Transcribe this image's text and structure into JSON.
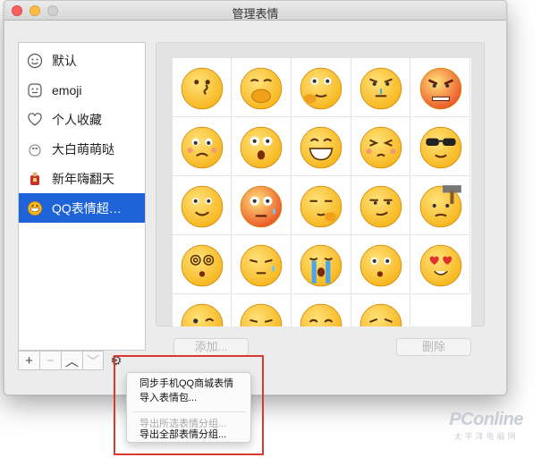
{
  "window": {
    "title": "管理表情"
  },
  "sidebar": {
    "items": [
      {
        "label": "默认",
        "icon": "smiley-outline-icon",
        "selected": false
      },
      {
        "label": "emoji",
        "icon": "emoji-face-outline-icon",
        "selected": false
      },
      {
        "label": "个人收藏",
        "icon": "heart-outline-icon",
        "selected": false
      },
      {
        "label": "大白萌萌哒",
        "icon": "baymax-icon",
        "selected": false
      },
      {
        "label": "新年嗨翻天",
        "icon": "new-year-icon",
        "selected": false
      },
      {
        "label": "QQ表情超…",
        "icon": "qq-face-icon",
        "selected": true
      }
    ],
    "toolbar": {
      "add": "+",
      "remove": "−",
      "up": "︿",
      "down": "﹀",
      "gear": "⚙"
    }
  },
  "grid": {
    "emojis": [
      "kiss-face-icon",
      "cover-mouth-face-icon",
      "thinking-face-icon",
      "sick-face-icon",
      "angry-fire-face-icon",
      "worried-face-icon",
      "shocked-face-icon",
      "grin-face-icon",
      "squint-face-icon",
      "sunglasses-face-icon",
      "smile-face-icon",
      "sweat-red-face-icon",
      "proud-face-icon",
      "smirk-face-icon",
      "hammer-face-icon",
      "dizzy-face-icon",
      "sweat-drop-face-icon",
      "crying-face-icon",
      "confused-face-icon",
      "heart-eyes-face-icon",
      "wink-face-icon",
      "annoyed-face-icon",
      "sad-face-icon",
      "frown-face-icon"
    ]
  },
  "buttons": {
    "add": "添加...",
    "delete": "删除"
  },
  "menu": {
    "items": [
      {
        "label": "同步手机QQ商城表情",
        "enabled": true
      },
      {
        "label": "导入表情包...",
        "enabled": true
      },
      {
        "label": "导出所选表情分组...",
        "enabled": false
      },
      {
        "label": "导出全部表情分组...",
        "enabled": true
      }
    ]
  },
  "watermark": {
    "main": "PConline",
    "sub": "太平洋电脑网"
  },
  "colors": {
    "selection": "#1e64d8",
    "highlight_box": "#d9392e",
    "face": "#f7b71f"
  }
}
